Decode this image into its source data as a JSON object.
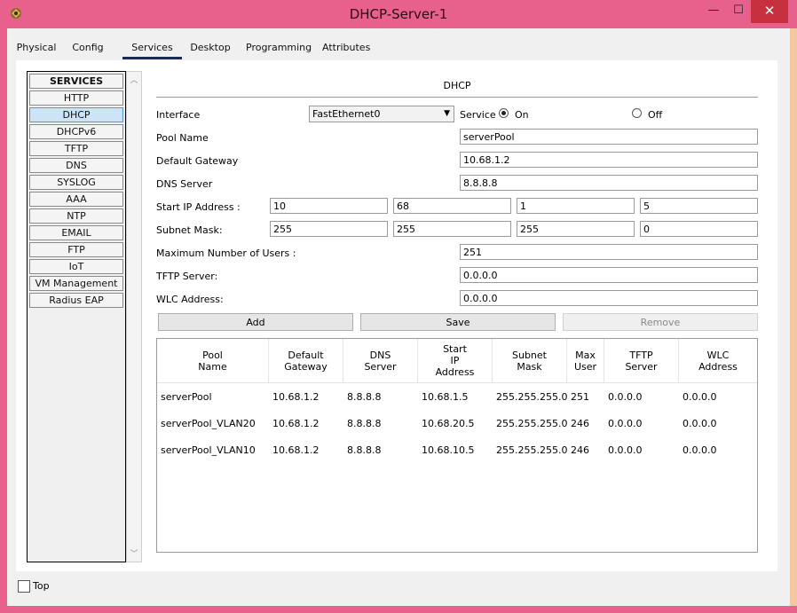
{
  "window": {
    "title": "DHCP-Server-1",
    "controls": {
      "minimize": "—",
      "maximize": "☐",
      "close": "✕"
    }
  },
  "tabs": [
    {
      "label": "Physical",
      "active": false
    },
    {
      "label": "Config",
      "active": false
    },
    {
      "label": "Services",
      "active": true
    },
    {
      "label": "Desktop",
      "active": false
    },
    {
      "label": "Programming",
      "active": false
    },
    {
      "label": "Attributes",
      "active": false
    }
  ],
  "services": {
    "header": "SERVICES",
    "items": [
      "HTTP",
      "DHCP",
      "DHCPv6",
      "TFTP",
      "DNS",
      "SYSLOG",
      "AAA",
      "NTP",
      "EMAIL",
      "FTP",
      "IoT",
      "VM Management",
      "Radius EAP"
    ],
    "selected": "DHCP"
  },
  "dhcp": {
    "title": "DHCP",
    "interface_label": "Interface",
    "interface_value": "FastEthernet0",
    "service_label": "Service",
    "on_label": "On",
    "off_label": "Off",
    "service_state": "On",
    "pool_name_label": "Pool Name",
    "pool_name": "serverPool",
    "gateway_label": "Default Gateway",
    "gateway": "10.68.1.2",
    "dns_label": "DNS Server",
    "dns": "8.8.8.8",
    "start_ip_label": "Start IP Address :",
    "start_ip": [
      "10",
      "68",
      "1",
      "5"
    ],
    "subnet_label": "Subnet Mask:",
    "subnet": [
      "255",
      "255",
      "255",
      "0"
    ],
    "max_users_label": "Maximum Number of Users :",
    "max_users": "251",
    "tftp_label": "TFTP Server:",
    "tftp": "0.0.0.0",
    "wlc_label": "WLC Address:",
    "wlc": "0.0.0.0",
    "buttons": {
      "add": "Add",
      "save": "Save",
      "remove": "Remove"
    },
    "table": {
      "headers": [
        [
          "Pool",
          "Name"
        ],
        [
          "Default",
          "Gateway"
        ],
        [
          "DNS",
          "Server"
        ],
        [
          "Start",
          "IP",
          "Address"
        ],
        [
          "Subnet",
          "Mask"
        ],
        [
          "Max",
          "User"
        ],
        [
          "TFTP",
          "Server"
        ],
        [
          "WLC",
          "Address"
        ]
      ],
      "rows": [
        [
          "serverPool",
          "10.68.1.2",
          "8.8.8.8",
          "10.68.1.5",
          "255.255.255.0",
          "251",
          "0.0.0.0",
          "0.0.0.0"
        ],
        [
          "serverPool_VLAN20",
          "10.68.1.2",
          "8.8.8.8",
          "10.68.20.5",
          "255.255.255.0",
          "246",
          "0.0.0.0",
          "0.0.0.0"
        ],
        [
          "serverPool_VLAN10",
          "10.68.1.2",
          "8.8.8.8",
          "10.68.10.5",
          "255.255.255.0",
          "246",
          "0.0.0.0",
          "0.0.0.0"
        ]
      ]
    }
  },
  "footer": {
    "top_label": "Top",
    "top_checked": false
  },
  "colors": {
    "window_frame": "#e8618c",
    "close_button": "#c7303f",
    "selected_item": "#cfe3f7",
    "active_tab_underline": "#1a2b57"
  }
}
